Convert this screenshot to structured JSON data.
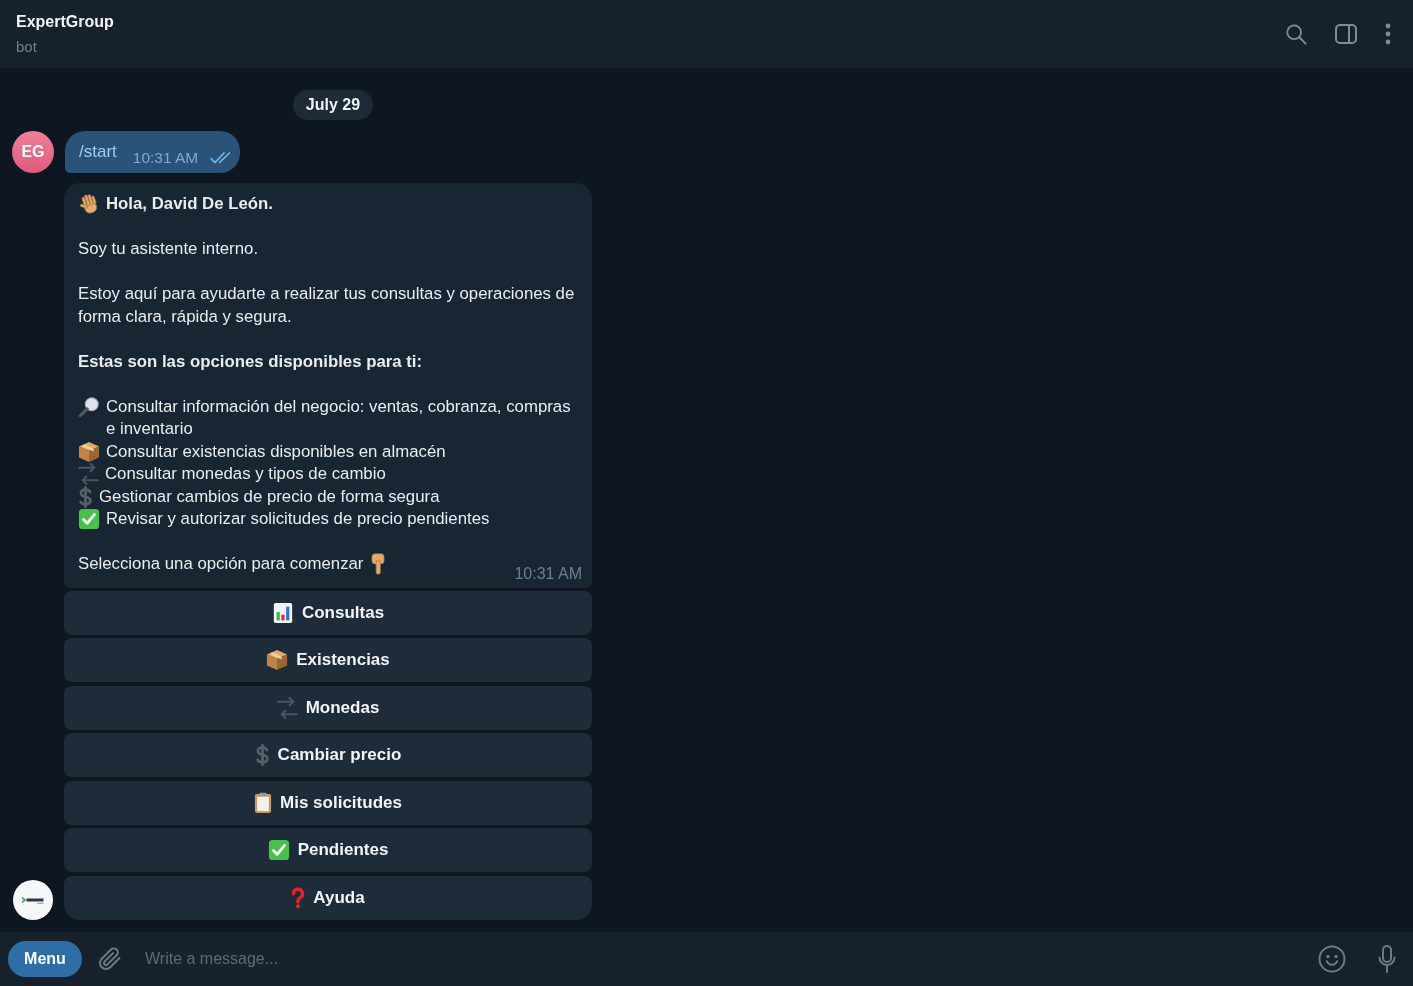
{
  "header": {
    "title": "ExpertGroup",
    "subtitle": "bot"
  },
  "date_separator": "July 29",
  "messages": [
    {
      "kind": "outgoing",
      "avatar": "EG",
      "text": "/start",
      "time": "10:31 AM",
      "read": true
    },
    {
      "kind": "bot",
      "greeting": "Hola, David De León.",
      "paragraphs": [
        "Soy tu asistente interno.",
        "Estoy aquí para ayudarte a realizar tus consultas y operaciones de forma clara, rápida y segura."
      ],
      "options_heading": "Estas son las opciones disponibles para ti:",
      "options": [
        "Consultar información del negocio: ventas, cobranza, compras e inventario",
        "Consultar existencias disponibles en almacén",
        "Consultar monedas y tipos de cambio",
        "Gestionar cambios de precio de forma segura",
        "Revisar y autorizar solicitudes de precio pendientes"
      ],
      "prompt": "Selecciona una opción para comenzar",
      "time": "10:31 AM",
      "keyboard": [
        "Consultas",
        "Existencias",
        "Monedas",
        "Cambiar precio",
        "Mis solicitudes",
        "Pendientes",
        "Ayuda"
      ]
    }
  ],
  "composer": {
    "button": "Menu",
    "placeholder": "Write a message..."
  }
}
